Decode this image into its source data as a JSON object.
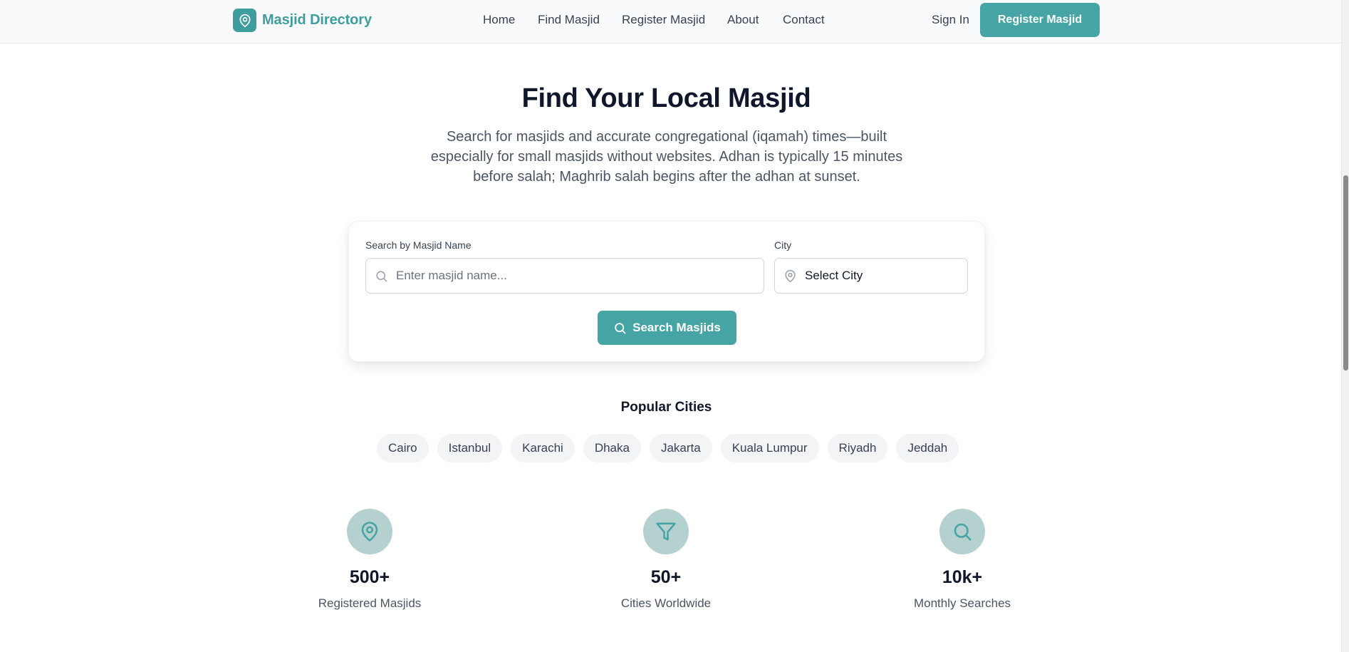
{
  "header": {
    "logo_text": "Masjid Directory",
    "nav": [
      "Home",
      "Find Masjid",
      "Register Masjid",
      "About",
      "Contact"
    ],
    "sign_in": "Sign In",
    "register_button": "Register Masjid"
  },
  "hero": {
    "title": "Find Your Local Masjid",
    "subtitle": "Search for masjids and accurate congregational (iqamah) times—built especially for small masjids without websites. Adhan is typically 15 minutes before salah; Maghrib salah begins after the adhan at sunset."
  },
  "search": {
    "name_label": "Search by Masjid Name",
    "name_placeholder": "Enter masjid name...",
    "name_value": "",
    "city_label": "City",
    "city_value": "Select City",
    "button_label": "Search Masjids"
  },
  "popular": {
    "title": "Popular Cities",
    "cities": [
      "Cairo",
      "Istanbul",
      "Karachi",
      "Dhaka",
      "Jakarta",
      "Kuala Lumpur",
      "Riyadh",
      "Jeddah"
    ]
  },
  "stats": [
    {
      "icon": "map-pin-icon",
      "value": "500+",
      "label": "Registered Masjids"
    },
    {
      "icon": "filter-icon",
      "value": "50+",
      "label": "Cities Worldwide"
    },
    {
      "icon": "search-icon",
      "value": "10k+",
      "label": "Monthly Searches"
    }
  ],
  "colors": {
    "accent": "#46a4a4",
    "logo": "#3f9e9d",
    "stat_circle": "#b4d1cf",
    "chip_bg": "#f3f4f6"
  }
}
